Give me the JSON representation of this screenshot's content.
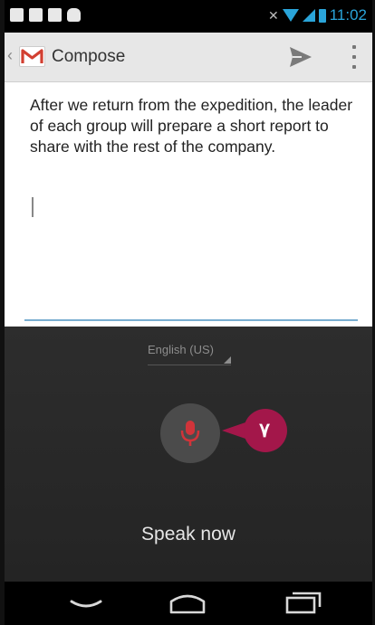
{
  "status_bar": {
    "time": "11:02",
    "notification_icons": [
      "notification-icon",
      "notification-icon",
      "notification-icon",
      "android-icon"
    ],
    "system_icons": [
      "vibrate-icon",
      "wifi-icon",
      "signal-icon",
      "battery-icon"
    ]
  },
  "action_bar": {
    "title": "Compose",
    "app_icon": "gmail-icon",
    "actions": [
      "send-icon",
      "overflow-menu-icon"
    ]
  },
  "compose": {
    "body": "After  we return from the expedition, the leader of each group will prepare a short report to share with the rest of the company."
  },
  "voice_input": {
    "language": "English (US)",
    "prompt": "Speak now",
    "callout_number": "۷"
  },
  "navigation_bar": {
    "buttons": [
      "back-icon",
      "home-icon",
      "recent-apps-icon"
    ]
  },
  "colors": {
    "accent": "#2aa4d9",
    "mic": "#d0343a",
    "callout": "#a3174a",
    "panel": "#2a2a2a"
  }
}
